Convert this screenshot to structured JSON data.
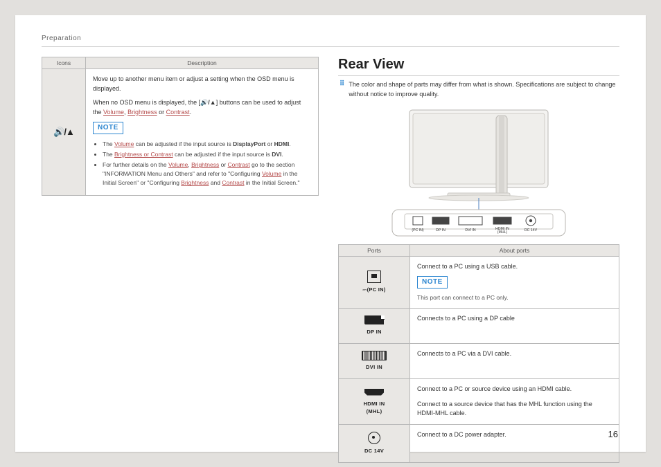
{
  "header": {
    "section": "Preparation"
  },
  "page_number": "16",
  "left": {
    "table_head": {
      "icons": "Icons",
      "desc": "Description"
    },
    "icon_label": "volume-up-arrow-icon",
    "p1": "Move up to another menu item or adjust a setting when the OSD menu is displayed.",
    "p2_a": "When no OSD menu is displayed, the [",
    "p2_b": "] buttons can be used to adjust the ",
    "link_volume": "Volume",
    "link_brightness": "Brightness",
    "link_contrast": "Contrast",
    "sep_comma": ", ",
    "sep_or": " or ",
    "period": ".",
    "note_label": "NOTE",
    "b1_a": "The ",
    "b1_link": "Volume",
    "b1_b": " can be adjusted if the input source is ",
    "b1_bold1": "DisplayPort",
    "b1_or": " or ",
    "b1_bold2": "HDMI",
    "b1_end": ".",
    "b2_a": "The ",
    "b2_link": "Brightness or Contrast",
    "b2_b": " can be adjusted if the input source is ",
    "b2_bold": "DVI",
    "b2_end": ".",
    "b3_a": "For further details on the ",
    "b3_l1": "Volume",
    "b3_c1": ", ",
    "b3_l2": "Brightness",
    "b3_or": " or ",
    "b3_l3": "Contrast",
    "b3_b": " go to the section \"INFORMATION Menu and Others\" and refer to \"Configuring ",
    "b3_l4": "Volume",
    "b3_c2": " in the Initial Screen\" or \"Configuring ",
    "b3_l5": "Brightness",
    "b3_and": " and ",
    "b3_l6": "Contrast",
    "b3_end": " in the Initial Screen.\""
  },
  "right": {
    "title": "Rear View",
    "lead": "The color and shape of parts may differ from what is shown. Specifications are subject to change without notice to improve quality.",
    "table_head": {
      "ports": "Ports",
      "about": "About ports"
    },
    "note_label": "NOTE",
    "rows": [
      {
        "icon": "usb",
        "label": "(PC IN)",
        "desc": "Connect to a PC using a USB cable.",
        "note": "This port can connect to a PC only."
      },
      {
        "icon": "dp",
        "label": "DP IN",
        "desc": "Connects to a PC using a DP cable"
      },
      {
        "icon": "dvi",
        "label": "DVI IN",
        "desc": "Connects to a PC via a DVI cable."
      },
      {
        "icon": "hdmi",
        "label": "HDMI IN\n(MHL)",
        "desc": "Connect to a PC or source device using an HDMI cable.",
        "desc2": "Connect to a source device that has the MHL function using the HDMI-MHL cable."
      },
      {
        "icon": "dc",
        "label": "DC 14V",
        "desc": "Connect to a DC power adapter."
      }
    ],
    "port_bar_labels": {
      "pcin": "(PC IN)",
      "dp": "DP IN",
      "dvi": "DVI IN",
      "hdmi": "HDMI IN\n(MHL)",
      "dc": "DC 14V"
    }
  }
}
